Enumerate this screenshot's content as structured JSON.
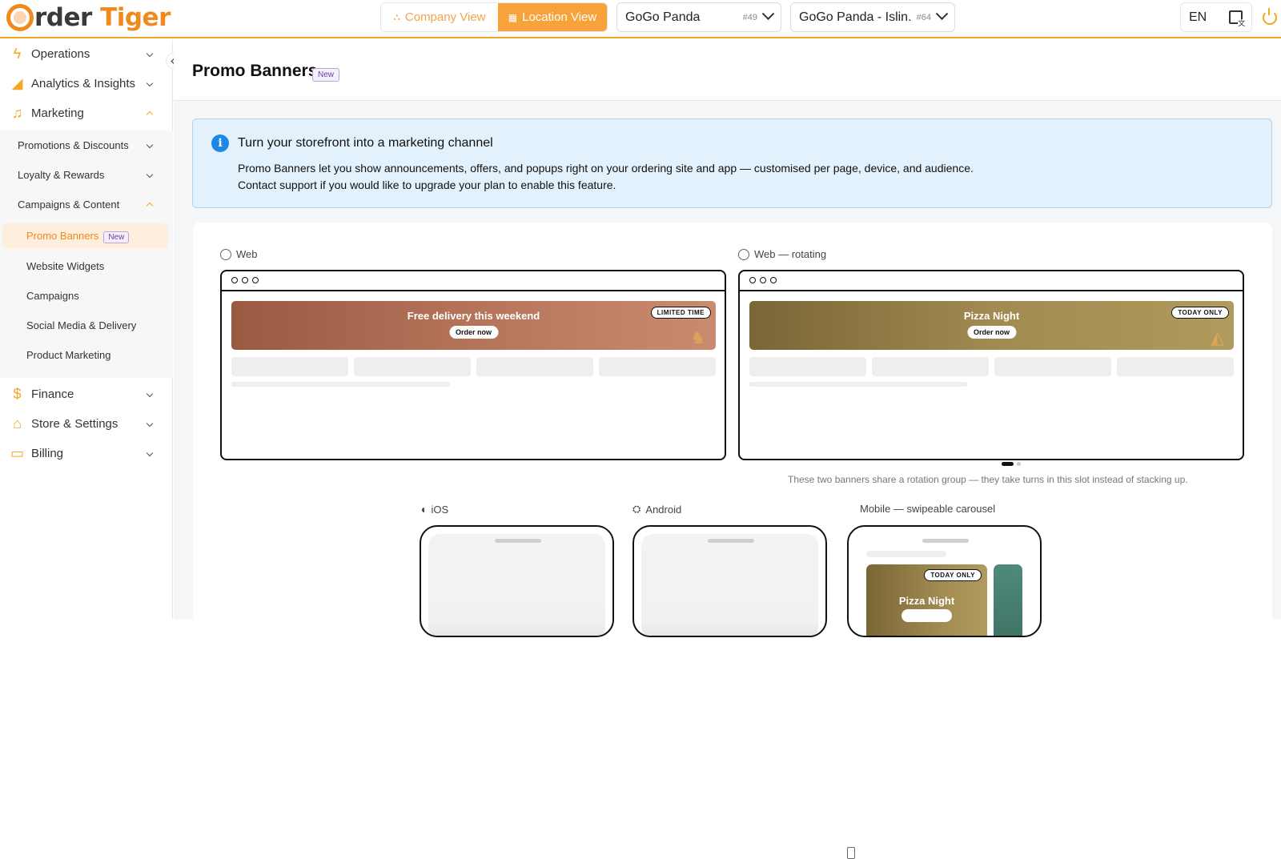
{
  "brand": {
    "logo_prefix": "rder ",
    "logo_suffix": "Tiger"
  },
  "header": {
    "company_view": "Company View",
    "location_view": "Location View",
    "company_select": {
      "value": "GoGo Panda",
      "id": "#49"
    },
    "location_select": {
      "value": "GoGo Panda - Islin...",
      "id": "#64"
    },
    "language": "EN"
  },
  "sidebar": {
    "items": [
      {
        "label": "Operations",
        "icon": "bolt-icon"
      },
      {
        "label": "Analytics & Insights",
        "icon": "chart-icon"
      },
      {
        "label": "Marketing",
        "icon": "bell-icon"
      }
    ],
    "marketing_sub": [
      {
        "label": "Promotions & Discounts"
      },
      {
        "label": "Loyalty & Rewards"
      },
      {
        "label": "Campaigns & Content"
      }
    ],
    "campaigns_leaves": [
      {
        "label": "Promo Banners",
        "badge": "New"
      },
      {
        "label": "Website Widgets"
      },
      {
        "label": "Campaigns"
      },
      {
        "label": "Social Media & Delivery"
      },
      {
        "label": "Product Marketing"
      }
    ],
    "bottom_items": [
      {
        "label": "Finance",
        "icon": "dollar-icon"
      },
      {
        "label": "Store & Settings",
        "icon": "store-icon"
      },
      {
        "label": "Billing",
        "icon": "card-icon"
      }
    ]
  },
  "page": {
    "title": "Promo Banners",
    "badge": "New",
    "info": {
      "title": "Turn your storefront into a marketing channel",
      "line1": "Promo Banners let you show announcements, offers, and popups right on your ordering site and app — customised per page, device, and audience.",
      "line2": "Contact support if you would like to upgrade your plan to enable this feature."
    },
    "previews": {
      "web_label": "Web",
      "web_rotating_label": "Web — rotating",
      "web_banner": {
        "title": "Free delivery this weekend",
        "cta": "Order now",
        "tag": "LIMITED TIME"
      },
      "rotating_banner": {
        "title": "Pizza Night",
        "cta": "Order now",
        "tag": "TODAY ONLY"
      },
      "rotation_note": "These two banners share a rotation group — they take turns in this slot instead of stacking up.",
      "ios_label": "iOS",
      "android_label": "Android",
      "mobile_label": "Mobile — swipeable carousel",
      "carousel_banner": {
        "title": "Pizza Night",
        "tag": "TODAY ONLY"
      }
    }
  },
  "colors": {
    "accent": "#f5a623",
    "info_bg": "#e3f1fc",
    "info_icon": "#1e88e5",
    "new_badge": "#6b3fa0"
  }
}
